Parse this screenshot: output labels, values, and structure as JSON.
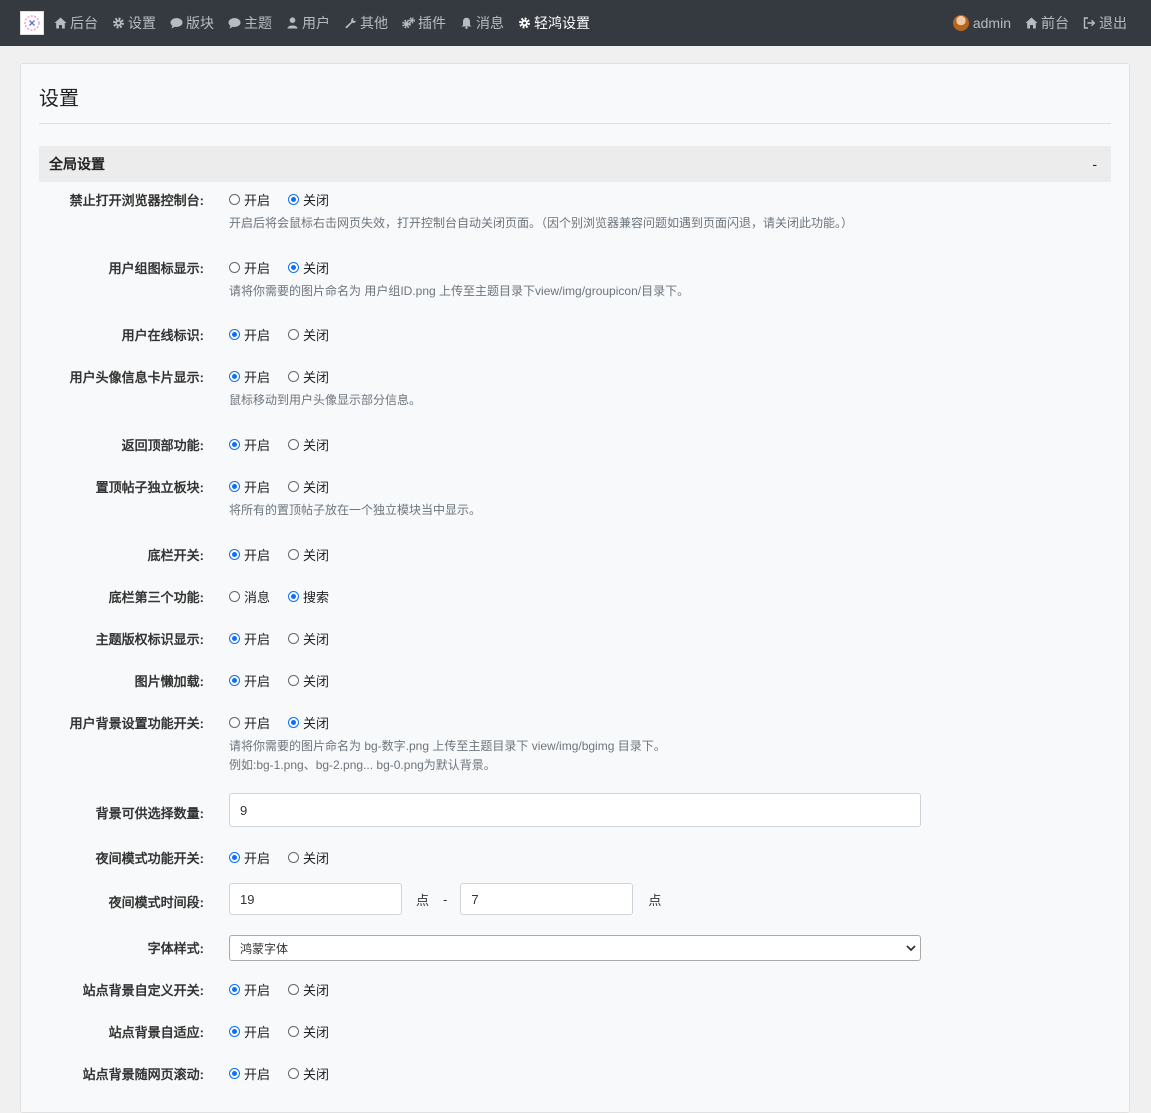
{
  "nav": {
    "items": [
      {
        "label": "后台",
        "icon": "home-icon",
        "active": false
      },
      {
        "label": "设置",
        "icon": "gear-icon",
        "active": false
      },
      {
        "label": "版块",
        "icon": "comment-icon",
        "active": false
      },
      {
        "label": "主题",
        "icon": "comment-icon",
        "active": false
      },
      {
        "label": "用户",
        "icon": "user-icon",
        "active": false
      },
      {
        "label": "其他",
        "icon": "wrench-icon",
        "active": false
      },
      {
        "label": "插件",
        "icon": "gears-icon",
        "active": false
      },
      {
        "label": "消息",
        "icon": "bell-icon",
        "active": false
      },
      {
        "label": "轻鸿设置",
        "icon": "gear-icon",
        "active": true
      }
    ],
    "user": {
      "label": "admin"
    },
    "front": {
      "label": "前台",
      "icon": "home-icon"
    },
    "logout": {
      "label": "退出",
      "icon": "sign-out-icon"
    }
  },
  "page": {
    "title": "设置"
  },
  "section": {
    "title": "全局设置",
    "toggle": "-"
  },
  "settings": [
    {
      "label": "禁止打开浏览器控制台:",
      "options": [
        "开启",
        "关闭"
      ],
      "selected": 1,
      "help": [
        "开启后将会鼠标右击网页失效，打开控制台自动关闭页面。（因个别浏览器兼容问题如遇到页面闪退，请关闭此功能。）"
      ]
    },
    {
      "label": "用户组图标显示:",
      "options": [
        "开启",
        "关闭"
      ],
      "selected": 1,
      "help": [
        "请将你需要的图片命名为 用户组ID.png 上传至主题目录下view/img/groupicon/目录下。"
      ]
    },
    {
      "label": "用户在线标识:",
      "options": [
        "开启",
        "关闭"
      ],
      "selected": 0
    },
    {
      "label": "用户头像信息卡片显示:",
      "options": [
        "开启",
        "关闭"
      ],
      "selected": 0,
      "help": [
        "鼠标移动到用户头像显示部分信息。"
      ]
    },
    {
      "label": "返回顶部功能:",
      "options": [
        "开启",
        "关闭"
      ],
      "selected": 0
    },
    {
      "label": "置顶帖子独立板块:",
      "options": [
        "开启",
        "关闭"
      ],
      "selected": 0,
      "help": [
        "将所有的置顶帖子放在一个独立模块当中显示。"
      ]
    },
    {
      "label": "底栏开关:",
      "options": [
        "开启",
        "关闭"
      ],
      "selected": 0
    },
    {
      "label": "底栏第三个功能:",
      "options": [
        "消息",
        "搜索"
      ],
      "selected": 1
    },
    {
      "label": "主题版权标识显示:",
      "options": [
        "开启",
        "关闭"
      ],
      "selected": 0
    },
    {
      "label": "图片懒加载:",
      "options": [
        "开启",
        "关闭"
      ],
      "selected": 0
    },
    {
      "label": "用户背景设置功能开关:",
      "options": [
        "开启",
        "关闭"
      ],
      "selected": 1,
      "help": [
        "请将你需要的图片命名为 bg-数字.png 上传至主题目录下 view/img/bgimg 目录下。",
        "例如:bg-1.png、bg-2.png... bg-0.png为默认背景。"
      ]
    },
    {
      "label": "背景可供选择数量:",
      "type": "input",
      "value": "9"
    },
    {
      "label": "夜间模式功能开关:",
      "options": [
        "开启",
        "关闭"
      ],
      "selected": 0
    },
    {
      "label": "夜间模式时间段:",
      "type": "range",
      "start": "19",
      "end": "7",
      "unit": "点",
      "separator": "-"
    },
    {
      "label": "字体样式:",
      "type": "select",
      "value": "鸿蒙字体"
    },
    {
      "label": "站点背景自定义开关:",
      "options": [
        "开启",
        "关闭"
      ],
      "selected": 0
    },
    {
      "label": "站点背景自适应:",
      "options": [
        "开启",
        "关闭"
      ],
      "selected": 0
    },
    {
      "label": "站点背景随网页滚动:",
      "options": [
        "开启",
        "关闭"
      ],
      "selected": 0
    }
  ]
}
